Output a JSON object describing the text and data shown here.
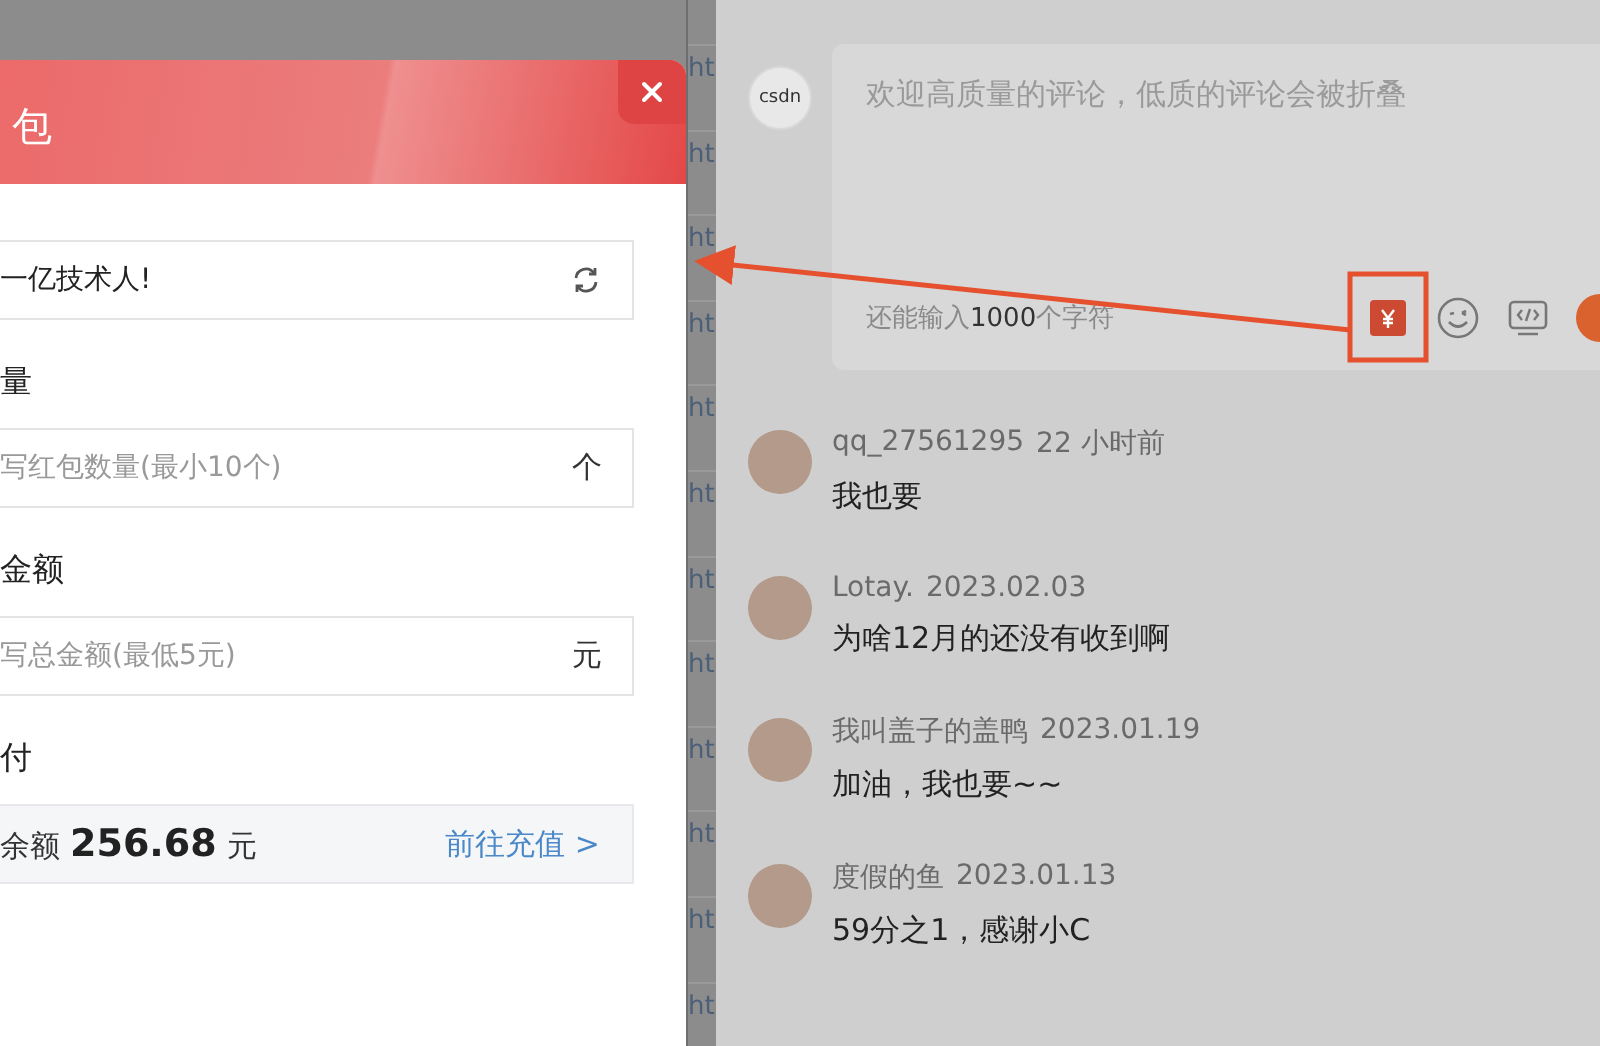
{
  "background_table": {
    "link_fragments": [
      "ht",
      "ht",
      "ht",
      "ht",
      "ht",
      "ht",
      "ht",
      "ht",
      "ht",
      "ht",
      "ht",
      "ht"
    ]
  },
  "modal": {
    "title": "包",
    "fields": [
      {
        "kind": "input",
        "value": "一亿技术人!",
        "refresh": true
      },
      {
        "kind": "input",
        "label": "量",
        "placeholder": "写红包数量(最小10个)",
        "suffix": "个"
      },
      {
        "kind": "input",
        "label": "金额",
        "placeholder": "写总金额(最低5元)",
        "suffix": "元"
      },
      {
        "kind": "balance",
        "label": "付",
        "balance_label": "余额",
        "amount": "256.68",
        "unit": "元",
        "link": "前往充值 >"
      }
    ]
  },
  "comment_editor": {
    "avatar_text": "csdn",
    "placeholder": "欢迎高质量的评论，低质的评论会被折叠",
    "counter_prefix": "还能输入",
    "counter_number": "1000",
    "counter_suffix": "个字符"
  },
  "comments": [
    {
      "author": "qq_27561295",
      "time": "22 小时前",
      "text": "我也要"
    },
    {
      "author": "Lotay.",
      "time": "2023.02.03",
      "text": "为啥12月的还没有收到啊"
    },
    {
      "author": "我叫盖子的盖鸭",
      "time": "2023.01.19",
      "text": "加油，我也要~~"
    },
    {
      "author": "度假的鱼",
      "time": "2023.01.13",
      "text": "59分之1，感谢小C"
    }
  ]
}
